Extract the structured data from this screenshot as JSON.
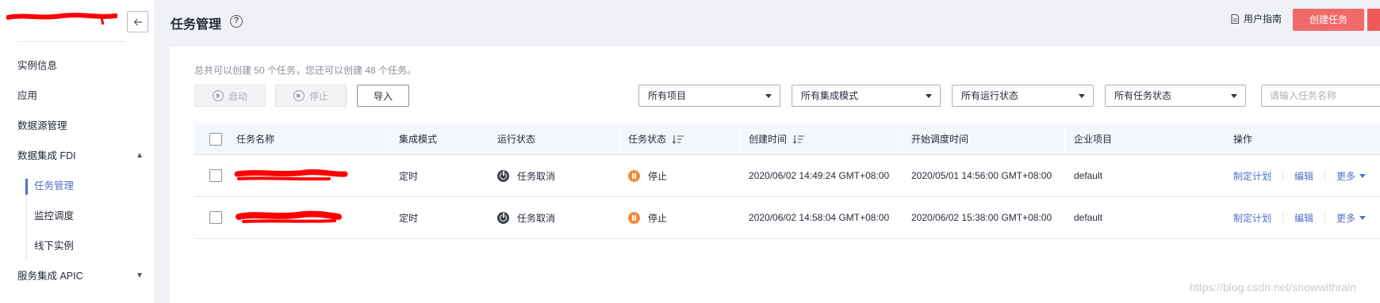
{
  "sidebar": {
    "collapse_icon": "arrow-left-icon",
    "items": [
      {
        "label": "实例信息"
      },
      {
        "label": "应用"
      },
      {
        "label": "数据源管理"
      },
      {
        "label": "数据集成 FDI",
        "expanded": true
      },
      {
        "label": "任务管理",
        "active": true
      },
      {
        "label": "监控调度"
      },
      {
        "label": "线下实例"
      },
      {
        "label": "服务集成 APIC",
        "expanded": false
      }
    ]
  },
  "header": {
    "title": "任务管理",
    "help_icon": "question-circle-icon",
    "guide_label": "用户指南",
    "create_label": "创建任务"
  },
  "quota_text": "总共可以创建 50 个任务，您还可以创建 48 个任务。",
  "toolbar": {
    "start_label": "启动",
    "stop_label": "停止",
    "import_label": "导入"
  },
  "filters": {
    "project": "所有项目",
    "mode": "所有集成模式",
    "run_status": "所有运行状态",
    "task_status": "所有任务状态",
    "search_placeholder": "请输入任务名称"
  },
  "table": {
    "columns": [
      "任务名称",
      "集成模式",
      "运行状态",
      "任务状态",
      "创建时间",
      "开始调度时间",
      "企业项目",
      "操作"
    ],
    "rows": [
      {
        "mode": "定时",
        "run_status": "任务取消",
        "task_status": "停止",
        "created": "2020/06/02 14:49:24 GMT+08:00",
        "schedule_start": "2020/05/01 14:56:00 GMT+08:00",
        "project": "default",
        "actions": [
          "制定计划",
          "编辑",
          "更多"
        ]
      },
      {
        "mode": "定时",
        "run_status": "任务取消",
        "task_status": "停止",
        "created": "2020/06/02 14:58:04 GMT+08:00",
        "schedule_start": "2020/06/02 15:38:00 GMT+08:00",
        "project": "default",
        "actions": [
          "制定计划",
          "编辑",
          "更多"
        ]
      }
    ]
  },
  "watermark": "https://blog.csdn.net/snowwithrain",
  "colors": {
    "accent": "#526ecc",
    "create": "#f16a6a",
    "stopped": "#f5893c",
    "redaction": "#ff0000"
  }
}
